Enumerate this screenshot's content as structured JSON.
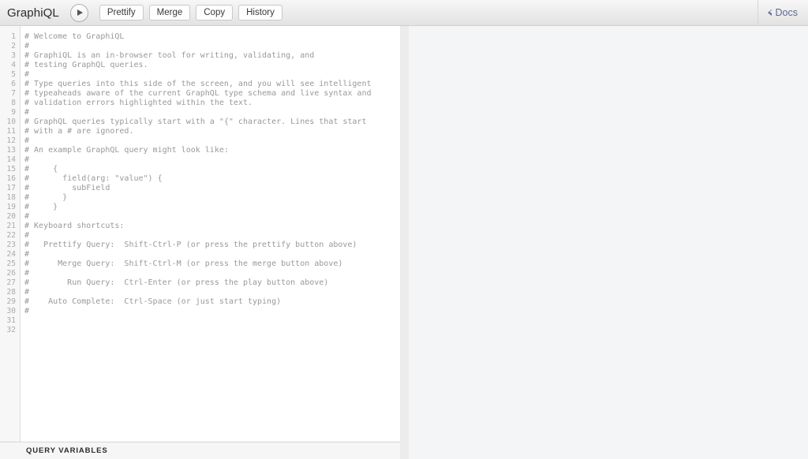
{
  "topbar": {
    "logo": "GraphiQL",
    "execute_title": "Execute Query",
    "buttons": [
      {
        "label": "Prettify"
      },
      {
        "label": "Merge"
      },
      {
        "label": "Copy"
      },
      {
        "label": "History"
      }
    ],
    "docs_label": "Docs"
  },
  "editor": {
    "line_numbers": [
      "1",
      "2",
      "3",
      "4",
      "5",
      "6",
      "7",
      "8",
      "9",
      "10",
      "11",
      "12",
      "13",
      "14",
      "15",
      "16",
      "17",
      "18",
      "19",
      "20",
      "21",
      "22",
      "23",
      "24",
      "25",
      "26",
      "27",
      "28",
      "29",
      "30",
      "31",
      "32"
    ],
    "lines": [
      "# Welcome to GraphiQL",
      "#",
      "# GraphiQL is an in-browser tool for writing, validating, and",
      "# testing GraphQL queries.",
      "#",
      "# Type queries into this side of the screen, and you will see intelligent",
      "# typeaheads aware of the current GraphQL type schema and live syntax and",
      "# validation errors highlighted within the text.",
      "#",
      "# GraphQL queries typically start with a \"{\" character. Lines that start",
      "# with a # are ignored.",
      "#",
      "# An example GraphQL query might look like:",
      "#",
      "#     {",
      "#       field(arg: \"value\") {",
      "#         subField",
      "#       }",
      "#     }",
      "#",
      "# Keyboard shortcuts:",
      "#",
      "#   Prettify Query:  Shift-Ctrl-P (or press the prettify button above)",
      "#",
      "#      Merge Query:  Shift-Ctrl-M (or press the merge button above)",
      "#",
      "#        Run Query:  Ctrl-Enter (or press the play button above)",
      "#",
      "#    Auto Complete:  Ctrl-Space (or just start typing)",
      "#",
      "",
      ""
    ]
  },
  "variables": {
    "title": "QUERY VARIABLES",
    "value": ""
  },
  "result": {
    "value": ""
  },
  "colors": {
    "comment": "#999999",
    "docs_link": "#5c6a92",
    "gutter_bg": "#f7f7f7",
    "result_bg": "#f4f5f7"
  }
}
